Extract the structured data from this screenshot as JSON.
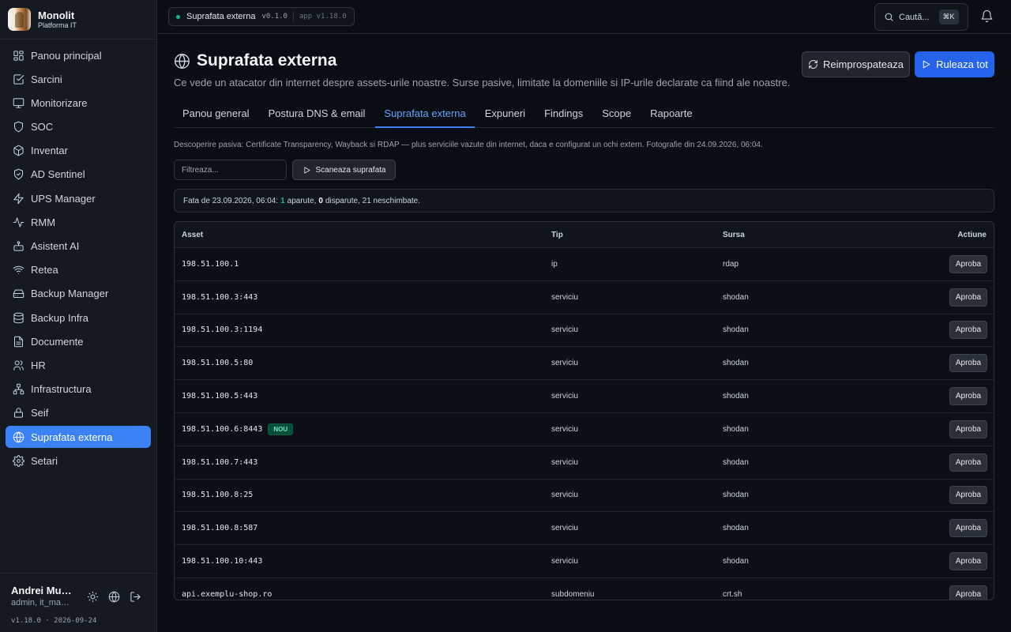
{
  "brand": {
    "name": "Monolit",
    "subtitle": "Platforma IT"
  },
  "sidebar": {
    "items": [
      {
        "label": "Panou principal",
        "icon": "dashboard-icon"
      },
      {
        "label": "Sarcini",
        "icon": "checkbox-icon"
      },
      {
        "label": "Monitorizare",
        "icon": "monitor-icon"
      },
      {
        "label": "SOC",
        "icon": "shield-icon"
      },
      {
        "label": "Inventar",
        "icon": "box-icon"
      },
      {
        "label": "AD Sentinel",
        "icon": "shield-check-icon"
      },
      {
        "label": "UPS Manager",
        "icon": "zap-icon"
      },
      {
        "label": "RMM",
        "icon": "activity-icon"
      },
      {
        "label": "Asistent AI",
        "icon": "bot-icon"
      },
      {
        "label": "Retea",
        "icon": "wifi-icon"
      },
      {
        "label": "Backup Manager",
        "icon": "drive-icon"
      },
      {
        "label": "Backup Infra",
        "icon": "database-icon"
      },
      {
        "label": "Documente",
        "icon": "file-icon"
      },
      {
        "label": "HR",
        "icon": "users-icon"
      },
      {
        "label": "Infrastructura",
        "icon": "network-icon"
      },
      {
        "label": "Seif",
        "icon": "lock-icon"
      },
      {
        "label": "Suprafata externa",
        "icon": "globe-icon",
        "active": true
      },
      {
        "label": "Setari",
        "icon": "gear-icon"
      }
    ]
  },
  "user": {
    "name": "Andrei Munteanu",
    "role": "admin, it_manager",
    "version": "v1.18.0 · 2026-09-24"
  },
  "topbar": {
    "env_label": "Suprafata externa",
    "env_version": "v0.1.0",
    "app_version": "app v1.18.0",
    "search_label": "Caută...",
    "search_kbd": "⌘K"
  },
  "page": {
    "title": "Suprafata externa",
    "description": "Ce vede un atacator din internet despre assets-urile noastre. Surse pasive, limitate la domeniile si IP-urile declarate ca fiind ale noastre.",
    "refresh_label": "Reimprospateaza",
    "run_label": "Ruleaza tot"
  },
  "tabs": [
    "Panou general",
    "Postura DNS & email",
    "Suprafata externa",
    "Expuneri",
    "Findings",
    "Scope",
    "Rapoarte"
  ],
  "active_tab": "Suprafata externa",
  "content": {
    "info": "Descoperire pasiva: Certificate Transparency, Wayback si RDAP — plus serviciile vazute din internet, daca e configurat un ochi extern. Fotografie din 24.09.2026, 06:04.",
    "filter_placeholder": "Filtreaza...",
    "scan_label": "Scaneaza suprafata",
    "diff": {
      "prefix": "Fata de 23.09.2026, 06:04:",
      "appeared": "1",
      "appeared_label": "aparute,",
      "disappeared": "0",
      "disappeared_label": "disparute, 21 neschimbate."
    }
  },
  "table": {
    "headers": {
      "asset": "Asset",
      "tip": "Tip",
      "sursa": "Sursa",
      "actiune": "Actiune"
    },
    "approve_label": "Aproba",
    "new_badge": "NOU",
    "rows": [
      {
        "asset": "198.51.100.1",
        "tip": "ip",
        "sursa": "rdap",
        "new": false
      },
      {
        "asset": "198.51.100.3:443",
        "tip": "serviciu",
        "sursa": "shodan",
        "new": false
      },
      {
        "asset": "198.51.100.3:1194",
        "tip": "serviciu",
        "sursa": "shodan",
        "new": false
      },
      {
        "asset": "198.51.100.5:80",
        "tip": "serviciu",
        "sursa": "shodan",
        "new": false
      },
      {
        "asset": "198.51.100.5:443",
        "tip": "serviciu",
        "sursa": "shodan",
        "new": false
      },
      {
        "asset": "198.51.100.6:8443",
        "tip": "serviciu",
        "sursa": "shodan",
        "new": true
      },
      {
        "asset": "198.51.100.7:443",
        "tip": "serviciu",
        "sursa": "shodan",
        "new": false
      },
      {
        "asset": "198.51.100.8:25",
        "tip": "serviciu",
        "sursa": "shodan",
        "new": false
      },
      {
        "asset": "198.51.100.8:587",
        "tip": "serviciu",
        "sursa": "shodan",
        "new": false
      },
      {
        "asset": "198.51.100.10:443",
        "tip": "serviciu",
        "sursa": "shodan",
        "new": false
      },
      {
        "asset": "api.exemplu-shop.ro",
        "tip": "subdomeniu",
        "sursa": "crt.sh",
        "new": false
      }
    ]
  },
  "colors": {
    "accent": "#3b82f6",
    "new_badge": "#064e3b",
    "diff_green": "#10b981"
  }
}
